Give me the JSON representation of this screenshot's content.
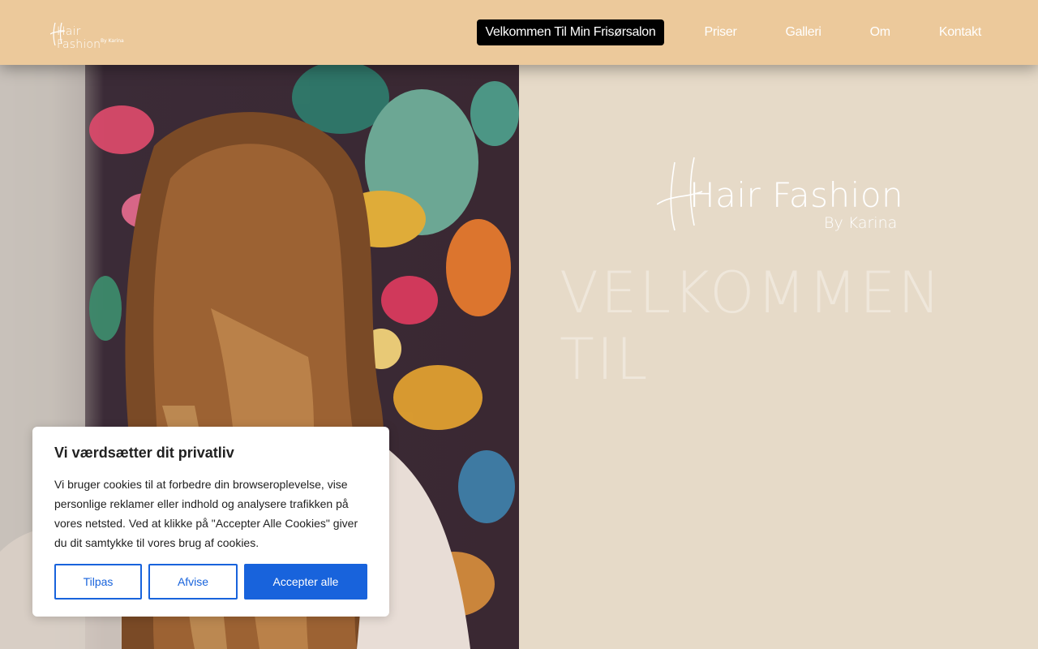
{
  "header": {
    "logo": {
      "word": "Hair Fashion",
      "by": "By Karina"
    },
    "nav": [
      {
        "label": "Velkommen Til Min Frisørsalon",
        "active": true
      },
      {
        "label": "Priser"
      },
      {
        "label": "Galleri"
      },
      {
        "label": "Om"
      },
      {
        "label": "Kontakt"
      }
    ]
  },
  "hero": {
    "logo": {
      "word": "Hair Fashion",
      "by": "By Karina"
    },
    "heading": "VELKOMMEN TIL"
  },
  "cookie": {
    "title": "Vi værdsætter dit privatliv",
    "text": "Vi bruger cookies til at forbedre din browseroplevelse, vise personlige reklamer eller indhold og analysere trafikken på vores netsted. Ved at klikke på \"Accepter Alle Cookies\" giver du dit samtykke til vores brug af cookies.",
    "customize_label": "Tilpas",
    "reject_label": "Afvise",
    "accept_label": "Accepter alle"
  },
  "colors": {
    "header_bg": "#ecc99b",
    "panel_bg": "#e6dac8",
    "accent": "#1863dc",
    "active_nav_bg": "#000000"
  }
}
